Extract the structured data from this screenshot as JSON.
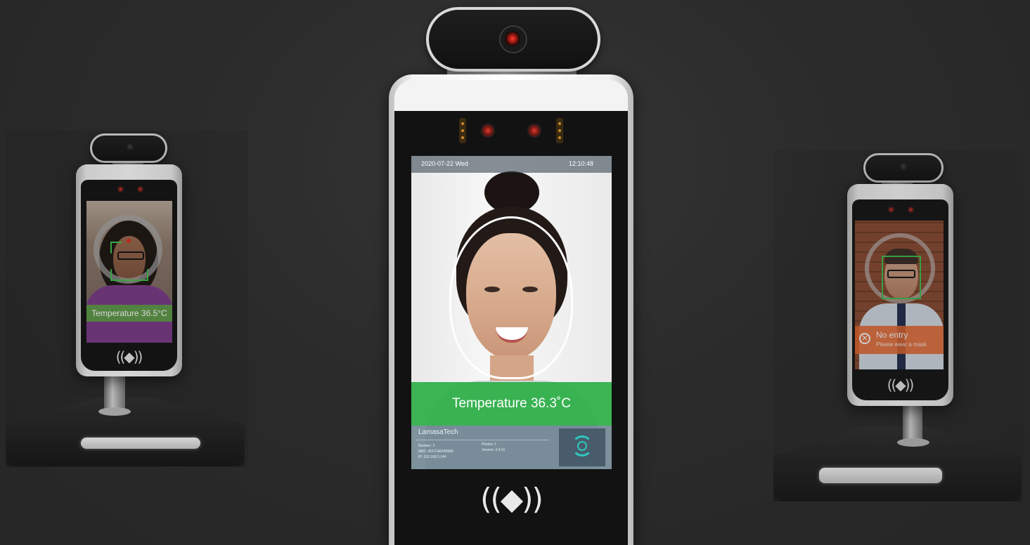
{
  "left_device": {
    "screen_message": "Temperature 36.5°C",
    "nfc_symbol": "((◆))"
  },
  "center_device": {
    "date": "2020-07-22 Wed",
    "time": "12:10:48",
    "temperature_message": "Temperature 36.3˚C",
    "brand": "LamasaTech",
    "info": {
      "number": "Number: 2",
      "mac": "MAC: 8CFCA0040686",
      "ip": "IP: 192.168.5.144",
      "photos": "Photos: 1",
      "version": "Version: 2.4.01"
    },
    "nfc_symbol": "((◆))"
  },
  "right_device": {
    "alert_title": "No entry",
    "alert_subtitle": "Please wear a mask",
    "nfc_symbol": "((◆))"
  },
  "colors": {
    "background": "#2b2b2b",
    "pass_green": "#2daf46",
    "deny_orange": "#e8662b",
    "face_frame_green": "#3ec24f"
  }
}
